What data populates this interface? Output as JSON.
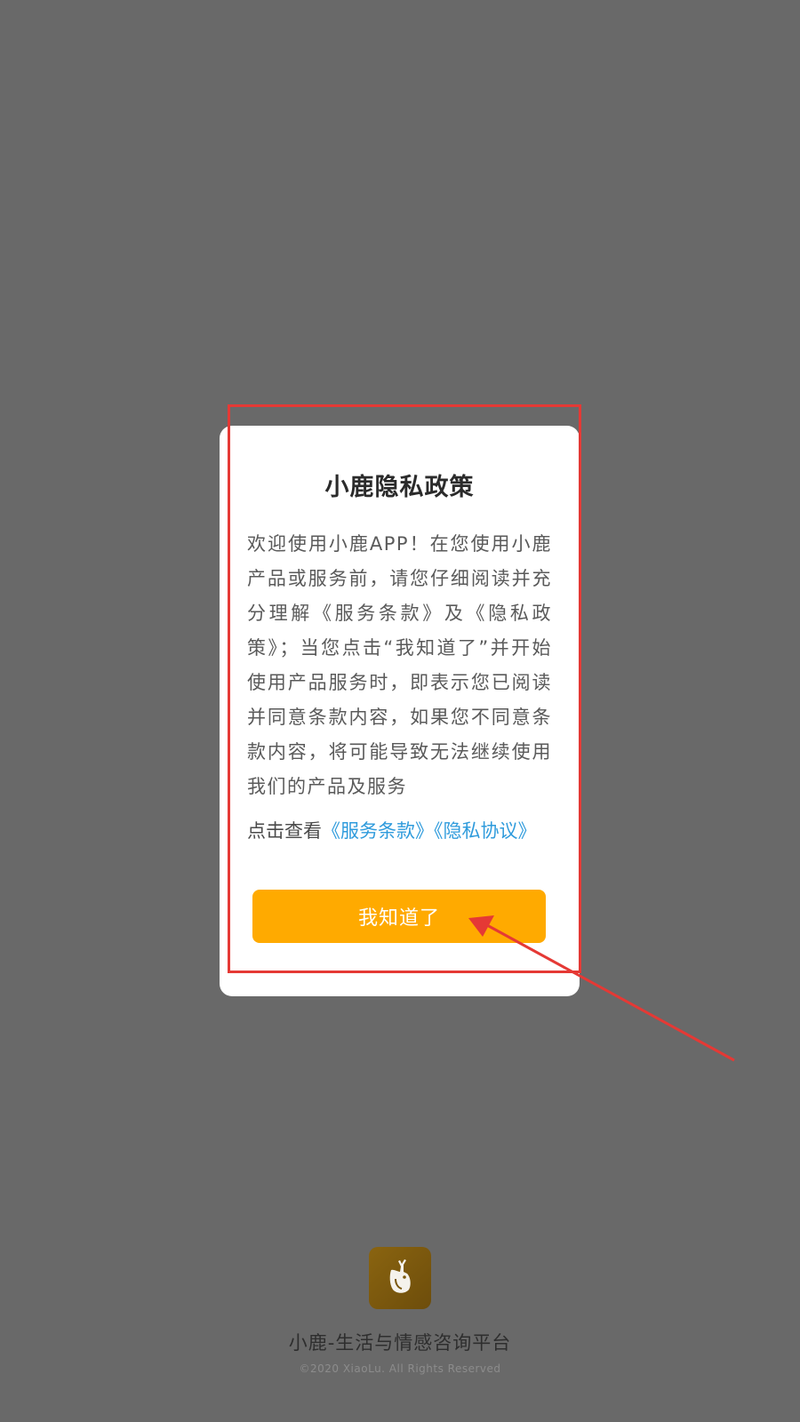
{
  "dialog": {
    "title": "小鹿隐私政策",
    "body": "欢迎使用小鹿APP！在您使用小鹿产品或服务前，请您仔细阅读并充分理解《服务条款》及《隐私政策》；当您点击“我知道了”并开始使用产品服务时，即表示您已阅读并同意条款内容，如果您不同意条款内容，将可能导致无法继续使用我们的产品及服务",
    "links_prefix": "点击查看",
    "terms_link": "《服务条款》",
    "privacy_link": "《隐私协议》",
    "confirm_label": "我知道了"
  },
  "footer": {
    "logo_icon": "deer-icon",
    "app_name": "小鹿-生活与情感咨询平台",
    "copyright": "©2020 XiaoLu. All Rights Reserved"
  },
  "colors": {
    "overlay": "#696969",
    "accent": "#ffaa00",
    "link": "#2f9bdc",
    "annotation": "#e53935"
  }
}
